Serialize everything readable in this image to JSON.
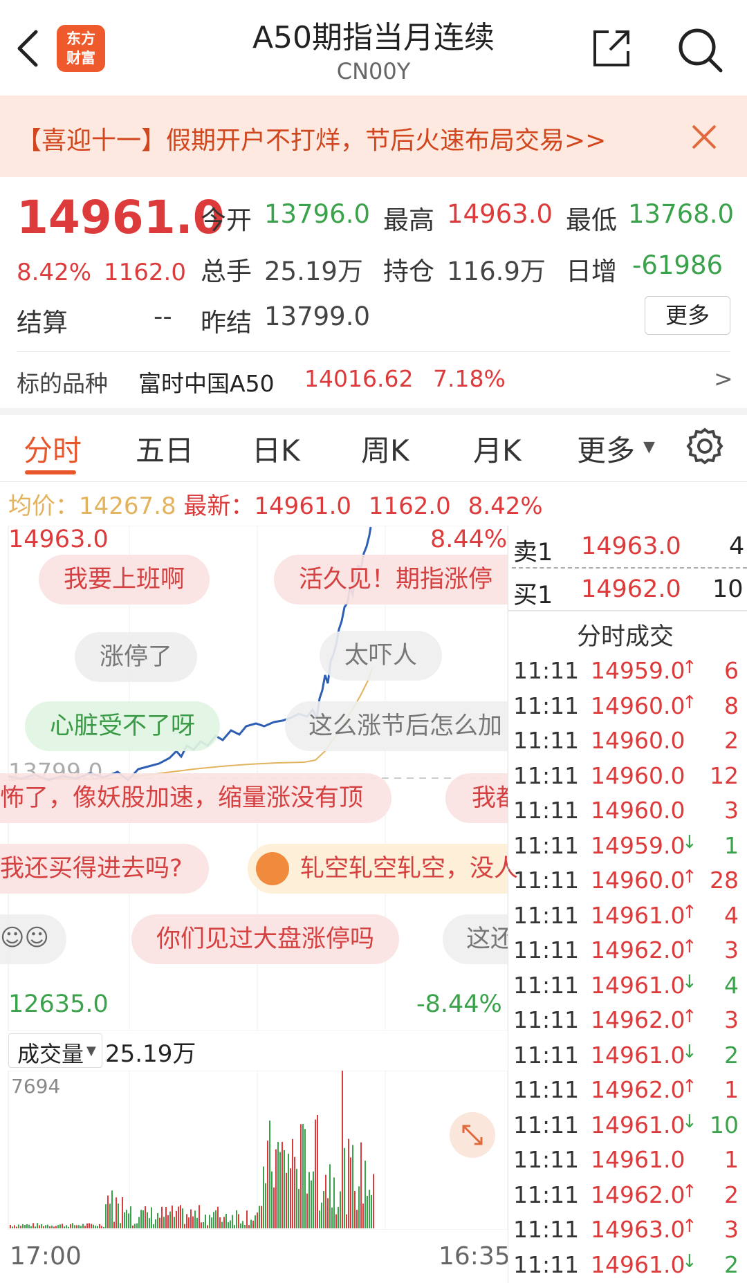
{
  "header": {
    "title": "A50期指当月连续",
    "subtitle": "CN00Y",
    "logo_line1": "东方",
    "logo_line2": "财富"
  },
  "banner": {
    "text": "【喜迎十一】假期开户不打烊，节后火速布局交易>>"
  },
  "quote": {
    "last": "14961.0",
    "pct": "8.42%",
    "change": "1162.0",
    "open_label": "今开",
    "open": "13796.0",
    "high_label": "最高",
    "high": "14963.0",
    "low_label": "最低",
    "low": "13768.0",
    "volume_label": "总手",
    "volume": "25.19万",
    "oi_label": "持仓",
    "oi": "116.9万",
    "daily_label": "日增",
    "daily": "-61986",
    "settle_label": "结算",
    "settle": "--",
    "prev_settle_label": "昨结",
    "prev_settle": "13799.0",
    "more_label": "更多"
  },
  "underlying": {
    "label": "标的品种",
    "name": "富时中国A50",
    "price": "14016.62",
    "pct": "7.18%",
    "arrow": ">"
  },
  "tabs": [
    {
      "label": "分时"
    },
    {
      "label": "五日"
    },
    {
      "label": "日K"
    },
    {
      "label": "周K"
    },
    {
      "label": "月K"
    },
    {
      "label": "更多"
    }
  ],
  "chart_info": {
    "avg_label": "均价：",
    "avg": "14267.8",
    "latest_label": "最新：",
    "latest": "14961.0",
    "change": "1162.0",
    "pct": "8.42%"
  },
  "price_chart": {
    "top_price": "14963.0",
    "top_pct": "8.44%",
    "bottom_price": "12635.0",
    "bottom_pct": "-8.44%",
    "base_price": "13799.0"
  },
  "bubbles": [
    {
      "text": "我要上班啊"
    },
    {
      "text": "活久见！期指涨停"
    },
    {
      "text": "涨停了"
    },
    {
      "text": "太吓人"
    },
    {
      "text": "心脏受不了呀"
    },
    {
      "text": "这么涨节后怎么加"
    },
    {
      "text": "怖了，像妖股加速，缩量涨没有顶"
    },
    {
      "text": "我都"
    },
    {
      "text": "我还买得进去吗?"
    },
    {
      "text": "轧空轧空轧空，没人"
    },
    {
      "text": "你们见过大盘涨停吗"
    },
    {
      "text": "这还"
    }
  ],
  "volume_chart": {
    "label": "成交量",
    "value": "25.19万",
    "max": "7694",
    "start_time": "17:00",
    "end_time": "16:35"
  },
  "order_book": {
    "sell_label": "卖1",
    "sell_price": "14963.0",
    "sell_qty": "4",
    "buy_label": "买1",
    "buy_price": "14962.0",
    "buy_qty": "10"
  },
  "trades_title": "分时成交",
  "trades": [
    {
      "time": "11:11",
      "price": "14959.0",
      "dir": "up",
      "qty": "6"
    },
    {
      "time": "11:11",
      "price": "14960.0",
      "dir": "up",
      "qty": "8"
    },
    {
      "time": "11:11",
      "price": "14960.0",
      "dir": "",
      "qty": "2"
    },
    {
      "time": "11:11",
      "price": "14960.0",
      "dir": "",
      "qty": "12"
    },
    {
      "time": "11:11",
      "price": "14960.0",
      "dir": "",
      "qty": "3"
    },
    {
      "time": "11:11",
      "price": "14959.0",
      "dir": "down",
      "qty": "1"
    },
    {
      "time": "11:11",
      "price": "14960.0",
      "dir": "up",
      "qty": "28"
    },
    {
      "time": "11:11",
      "price": "14961.0",
      "dir": "up",
      "qty": "4"
    },
    {
      "time": "11:11",
      "price": "14962.0",
      "dir": "up",
      "qty": "3"
    },
    {
      "time": "11:11",
      "price": "14961.0",
      "dir": "down",
      "qty": "4"
    },
    {
      "time": "11:11",
      "price": "14962.0",
      "dir": "up",
      "qty": "3"
    },
    {
      "time": "11:11",
      "price": "14961.0",
      "dir": "down",
      "qty": "2"
    },
    {
      "time": "11:11",
      "price": "14962.0",
      "dir": "up",
      "qty": "1"
    },
    {
      "time": "11:11",
      "price": "14961.0",
      "dir": "down",
      "qty": "10"
    },
    {
      "time": "11:11",
      "price": "14961.0",
      "dir": "",
      "qty": "1"
    },
    {
      "time": "11:11",
      "price": "14962.0",
      "dir": "up",
      "qty": "2"
    },
    {
      "time": "11:11",
      "price": "14963.0",
      "dir": "up",
      "qty": "3"
    },
    {
      "time": "11:11",
      "price": "14961.0",
      "dir": "down",
      "qty": "2"
    }
  ],
  "colors": {
    "up": "#dd3b3b",
    "down": "#3aa24a",
    "accent": "#e8562c",
    "price_line": "#2f5fb3",
    "avg_line": "#e3b25c"
  }
}
